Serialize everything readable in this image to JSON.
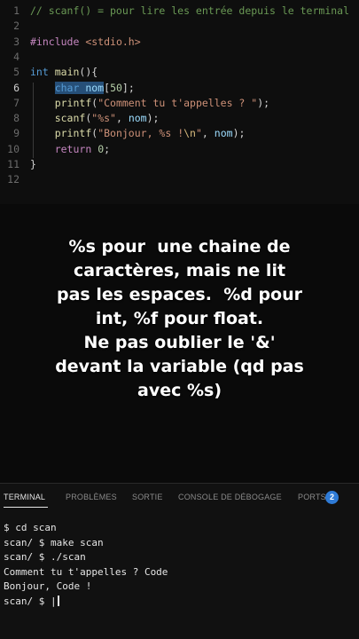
{
  "editor": {
    "active_line": 6,
    "lines": [
      {
        "n": "1",
        "tokens": [
          {
            "c": "cmt",
            "t": "// scanf() = pour lire les entrée depuis le terminal"
          }
        ]
      },
      {
        "n": "2",
        "tokens": []
      },
      {
        "n": "3",
        "tokens": [
          {
            "c": "kw",
            "t": "#include"
          },
          {
            "c": "",
            "t": " "
          },
          {
            "c": "inc",
            "t": "<stdio.h>"
          }
        ]
      },
      {
        "n": "4",
        "tokens": []
      },
      {
        "n": "5",
        "tokens": [
          {
            "c": "type",
            "t": "int"
          },
          {
            "c": "",
            "t": " "
          },
          {
            "c": "fn",
            "t": "main"
          },
          {
            "c": "",
            "t": "(){"
          }
        ]
      },
      {
        "n": "6",
        "tokens": [
          {
            "c": "",
            "t": "    "
          },
          {
            "c": "type sel",
            "t": "char"
          },
          {
            "c": "sel",
            "t": " "
          },
          {
            "c": "var sel",
            "t": "nom"
          },
          {
            "c": "",
            "t": "["
          },
          {
            "c": "num",
            "t": "50"
          },
          {
            "c": "",
            "t": "];"
          }
        ]
      },
      {
        "n": "7",
        "tokens": [
          {
            "c": "",
            "t": "    "
          },
          {
            "c": "fn",
            "t": "printf"
          },
          {
            "c": "",
            "t": "("
          },
          {
            "c": "str",
            "t": "\"Comment tu t'appelles ? \""
          },
          {
            "c": "",
            "t": ");"
          }
        ]
      },
      {
        "n": "8",
        "tokens": [
          {
            "c": "",
            "t": "    "
          },
          {
            "c": "fn",
            "t": "scanf"
          },
          {
            "c": "",
            "t": "("
          },
          {
            "c": "str",
            "t": "\"%s\""
          },
          {
            "c": "",
            "t": ", "
          },
          {
            "c": "var",
            "t": "nom"
          },
          {
            "c": "",
            "t": ");"
          }
        ]
      },
      {
        "n": "9",
        "tokens": [
          {
            "c": "",
            "t": "    "
          },
          {
            "c": "fn",
            "t": "printf"
          },
          {
            "c": "",
            "t": "("
          },
          {
            "c": "str",
            "t": "\"Bonjour, %s !"
          },
          {
            "c": "esc",
            "t": "\\n"
          },
          {
            "c": "str",
            "t": "\""
          },
          {
            "c": "",
            "t": ", "
          },
          {
            "c": "var",
            "t": "nom"
          },
          {
            "c": "",
            "t": ");"
          }
        ]
      },
      {
        "n": "10",
        "tokens": [
          {
            "c": "",
            "t": "    "
          },
          {
            "c": "kw",
            "t": "return"
          },
          {
            "c": "",
            "t": " "
          },
          {
            "c": "num",
            "t": "0"
          },
          {
            "c": "",
            "t": ";"
          }
        ]
      },
      {
        "n": "11",
        "tokens": [
          {
            "c": "",
            "t": "}"
          }
        ]
      },
      {
        "n": "12",
        "tokens": []
      }
    ]
  },
  "caption": {
    "lines": [
      "%s pour  une chaine de",
      "caractères, mais ne lit",
      "pas les espaces.  %d pour",
      "int, %f pour float.",
      "Ne pas oublier le '&'",
      "devant la variable (qd pas",
      "avec %s)"
    ]
  },
  "panel": {
    "tabs": {
      "terminal": "TERMINAL",
      "problems": "PROBLÈMES",
      "output": "SORTIE",
      "debug_console": "CONSOLE DE DÉBOGAGE",
      "ports": "PORTS"
    },
    "ports_badge": "2",
    "terminal_lines": [
      "$ cd scan",
      "scan/ $ make scan",
      "scan/ $ ./scan",
      "Comment tu t'appelles ? Code",
      "Bonjour, Code !",
      "scan/ $ |"
    ]
  }
}
